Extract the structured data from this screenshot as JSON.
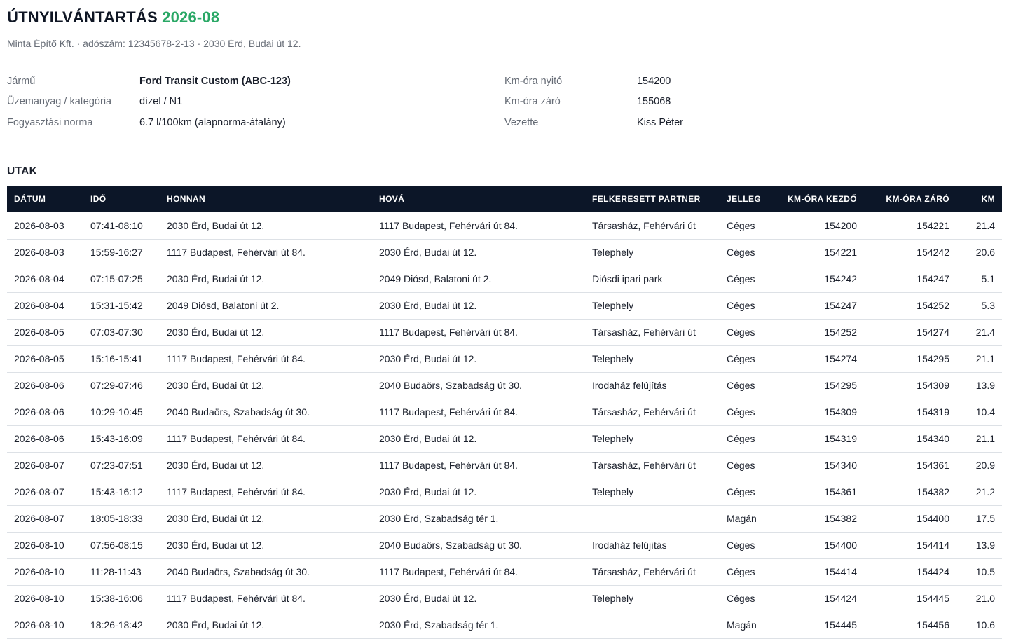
{
  "header": {
    "title": "ÚTNYILVÁNTARTÁS",
    "period": "2026-08",
    "subtitle": "Minta Építő Kft. · adószám: 12345678-2-13 · 2030 Érd, Budai út 12."
  },
  "meta": {
    "vehicle_label": "Jármű",
    "vehicle_value": "Ford Transit Custom (ABC-123)",
    "fuel_label": "Üzemanyag / kategória",
    "fuel_value": "dízel / N1",
    "norm_label": "Fogyasztási norma",
    "norm_value": "6.7 l/100km (alapnorma-átalány)",
    "odo_open_label": "Km-óra nyitó",
    "odo_open_value": "154200",
    "odo_close_label": "Km-óra záró",
    "odo_close_value": "155068",
    "driver_label": "Vezette",
    "driver_value": "Kiss Péter"
  },
  "trips": {
    "section_title": "UTAK",
    "columns": [
      "DÁTUM",
      "IDŐ",
      "HONNAN",
      "HOVÁ",
      "FELKERESETT PARTNER",
      "JELLEG",
      "KM-ÓRA KEZDŐ",
      "KM-ÓRA ZÁRÓ",
      "KM"
    ],
    "rows": [
      [
        "2026-08-03",
        "07:41-08:10",
        "2030 Érd, Budai út 12.",
        "1117 Budapest, Fehérvári út 84.",
        "Társasház, Fehérvári út",
        "Céges",
        "154200",
        "154221",
        "21.4"
      ],
      [
        "2026-08-03",
        "15:59-16:27",
        "1117 Budapest, Fehérvári út 84.",
        "2030 Érd, Budai út 12.",
        "Telephely",
        "Céges",
        "154221",
        "154242",
        "20.6"
      ],
      [
        "2026-08-04",
        "07:15-07:25",
        "2030 Érd, Budai út 12.",
        "2049 Diósd, Balatoni út 2.",
        "Diósdi ipari park",
        "Céges",
        "154242",
        "154247",
        "5.1"
      ],
      [
        "2026-08-04",
        "15:31-15:42",
        "2049 Diósd, Balatoni út 2.",
        "2030 Érd, Budai út 12.",
        "Telephely",
        "Céges",
        "154247",
        "154252",
        "5.3"
      ],
      [
        "2026-08-05",
        "07:03-07:30",
        "2030 Érd, Budai út 12.",
        "1117 Budapest, Fehérvári út 84.",
        "Társasház, Fehérvári út",
        "Céges",
        "154252",
        "154274",
        "21.4"
      ],
      [
        "2026-08-05",
        "15:16-15:41",
        "1117 Budapest, Fehérvári út 84.",
        "2030 Érd, Budai út 12.",
        "Telephely",
        "Céges",
        "154274",
        "154295",
        "21.1"
      ],
      [
        "2026-08-06",
        "07:29-07:46",
        "2030 Érd, Budai út 12.",
        "2040 Budaörs, Szabadság út 30.",
        "Irodaház felújítás",
        "Céges",
        "154295",
        "154309",
        "13.9"
      ],
      [
        "2026-08-06",
        "10:29-10:45",
        "2040 Budaörs, Szabadság út 30.",
        "1117 Budapest, Fehérvári út 84.",
        "Társasház, Fehérvári út",
        "Céges",
        "154309",
        "154319",
        "10.4"
      ],
      [
        "2026-08-06",
        "15:43-16:09",
        "1117 Budapest, Fehérvári út 84.",
        "2030 Érd, Budai út 12.",
        "Telephely",
        "Céges",
        "154319",
        "154340",
        "21.1"
      ],
      [
        "2026-08-07",
        "07:23-07:51",
        "2030 Érd, Budai út 12.",
        "1117 Budapest, Fehérvári út 84.",
        "Társasház, Fehérvári út",
        "Céges",
        "154340",
        "154361",
        "20.9"
      ],
      [
        "2026-08-07",
        "15:43-16:12",
        "1117 Budapest, Fehérvári út 84.",
        "2030 Érd, Budai út 12.",
        "Telephely",
        "Céges",
        "154361",
        "154382",
        "21.2"
      ],
      [
        "2026-08-07",
        "18:05-18:33",
        "2030 Érd, Budai út 12.",
        "2030 Érd, Szabadság tér 1.",
        "",
        "Magán",
        "154382",
        "154400",
        "17.5"
      ],
      [
        "2026-08-10",
        "07:56-08:15",
        "2030 Érd, Budai út 12.",
        "2040 Budaörs, Szabadság út 30.",
        "Irodaház felújítás",
        "Céges",
        "154400",
        "154414",
        "13.9"
      ],
      [
        "2026-08-10",
        "11:28-11:43",
        "2040 Budaörs, Szabadság út 30.",
        "1117 Budapest, Fehérvári út 84.",
        "Társasház, Fehérvári út",
        "Céges",
        "154414",
        "154424",
        "10.5"
      ],
      [
        "2026-08-10",
        "15:38-16:06",
        "1117 Budapest, Fehérvári út 84.",
        "2030 Érd, Budai út 12.",
        "Telephely",
        "Céges",
        "154424",
        "154445",
        "21.0"
      ],
      [
        "2026-08-10",
        "18:26-18:42",
        "2030 Érd, Budai út 12.",
        "2030 Érd, Szabadság tér 1.",
        "",
        "Magán",
        "154445",
        "154456",
        "10.6"
      ]
    ]
  }
}
